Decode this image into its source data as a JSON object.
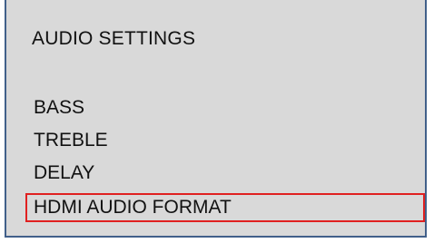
{
  "panel": {
    "title": "AUDIO SETTINGS"
  },
  "menu": {
    "items": [
      {
        "label": "BASS"
      },
      {
        "label": "TREBLE"
      },
      {
        "label": "DELAY"
      },
      {
        "label": "HDMI AUDIO FORMAT",
        "selected": true
      }
    ]
  },
  "colors": {
    "panel_background": "#d9d9d9",
    "panel_border": "#41608a",
    "selection_highlight": "#e02020"
  }
}
